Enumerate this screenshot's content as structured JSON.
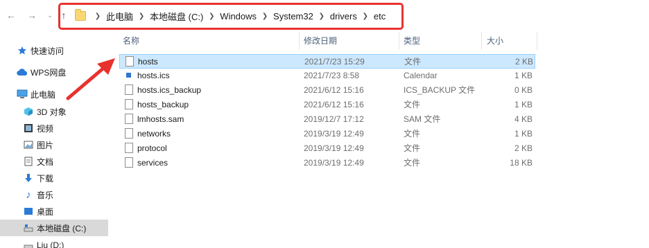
{
  "nav": {
    "back_icon": "arrow-left-icon",
    "forward_icon": "arrow-right-icon",
    "recent_icon": "chevron-down-icon",
    "up_icon": "arrow-up-icon"
  },
  "address_bar": {
    "crumbs": [
      "此电脑",
      "本地磁盘 (C:)",
      "Windows",
      "System32",
      "drivers",
      "etc"
    ]
  },
  "sidebar": {
    "items": [
      {
        "label": "快速访问",
        "icon": "star-icon"
      },
      {
        "label": "WPS网盘",
        "icon": "cloud-icon"
      },
      {
        "label": "此电脑",
        "icon": "computer-icon"
      },
      {
        "label": "3D 对象",
        "icon": "cube-icon"
      },
      {
        "label": "视频",
        "icon": "video-icon"
      },
      {
        "label": "图片",
        "icon": "picture-icon"
      },
      {
        "label": "文档",
        "icon": "document-icon"
      },
      {
        "label": "下载",
        "icon": "download-icon"
      },
      {
        "label": "音乐",
        "icon": "music-icon"
      },
      {
        "label": "桌面",
        "icon": "desktop-icon"
      },
      {
        "label": "本地磁盘 (C:)",
        "icon": "drive-icon"
      },
      {
        "label": "Liu (D:)",
        "icon": "drive-icon"
      }
    ]
  },
  "columns": {
    "name": "名称",
    "date": "修改日期",
    "type": "类型",
    "size": "大小"
  },
  "files": [
    {
      "name": "hosts",
      "date": "2021/7/23 15:29",
      "type": "文件",
      "size": "2 KB"
    },
    {
      "name": "hosts.ics",
      "date": "2021/7/23 8:58",
      "type": "Calendar",
      "size": "1 KB"
    },
    {
      "name": "hosts.ics_backup",
      "date": "2021/6/12 15:16",
      "type": "ICS_BACKUP 文件",
      "size": "0 KB"
    },
    {
      "name": "hosts_backup",
      "date": "2021/6/12 15:16",
      "type": "文件",
      "size": "1 KB"
    },
    {
      "name": "lmhosts.sam",
      "date": "2019/12/7 17:12",
      "type": "SAM 文件",
      "size": "4 KB"
    },
    {
      "name": "networks",
      "date": "2019/3/19 12:49",
      "type": "文件",
      "size": "1 KB"
    },
    {
      "name": "protocol",
      "date": "2019/3/19 12:49",
      "type": "文件",
      "size": "2 KB"
    },
    {
      "name": "services",
      "date": "2019/3/19 12:49",
      "type": "文件",
      "size": "18 KB"
    }
  ],
  "colors": {
    "highlight_box": "#e8322e",
    "selected_row": "#cce8ff",
    "selected_sidebar": "#d9d9d9"
  }
}
